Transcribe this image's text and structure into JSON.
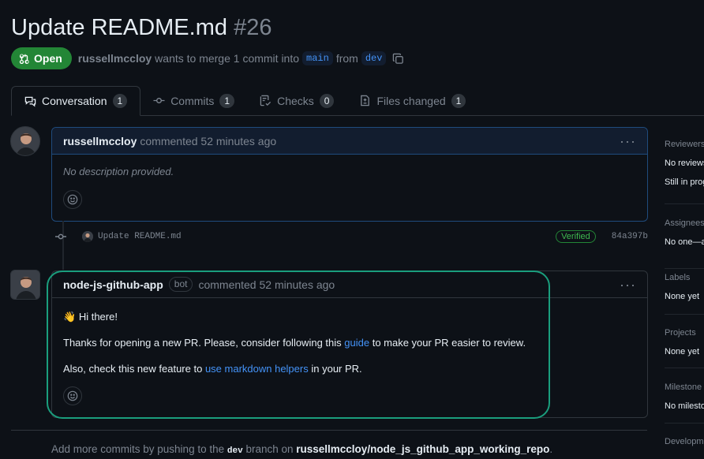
{
  "pr": {
    "title": "Update README.md",
    "number": "#26",
    "state": "Open",
    "author": "russellmccloy",
    "merge_text_a": "wants to merge 1 commit into",
    "base_branch": "main",
    "merge_text_b": "from",
    "head_branch": "dev"
  },
  "tabs": [
    {
      "label": "Conversation",
      "count": "1"
    },
    {
      "label": "Commits",
      "count": "1"
    },
    {
      "label": "Checks",
      "count": "0"
    },
    {
      "label": "Files changed",
      "count": "1"
    }
  ],
  "comment1": {
    "author": "russellmccloy",
    "meta": "commented 52 minutes ago",
    "body": "No description provided."
  },
  "commit": {
    "message": "Update README.md",
    "verified": "Verified",
    "sha": "84a397b"
  },
  "comment2": {
    "author": "node-js-github-app",
    "badge": "bot",
    "meta": "commented 52 minutes ago",
    "greeting": "Hi there!",
    "line2_a": "Thanks for opening a new PR. Please, consider following this",
    "line2_link": "guide",
    "line2_b": "to make your PR easier to review.",
    "line3_a": "Also, check this new feature to",
    "line3_link": "use markdown helpers",
    "line3_b": "in your PR."
  },
  "footer": {
    "a": "Add more commits by pushing to the",
    "branch": "dev",
    "b": "branch on",
    "repo": "russellmccloy/node_js_github_app_working_repo",
    "end": "."
  },
  "sidebar": {
    "reviewers_h": "Reviewers",
    "reviewers_v1": "No reviews",
    "reviewers_v2": "Still in prog",
    "assignees_h": "Assignees",
    "assignees_v": "No one—a",
    "labels_h": "Labels",
    "labels_v": "None yet",
    "projects_h": "Projects",
    "projects_v": "None yet",
    "milestone_h": "Milestone",
    "milestone_v": "No milesto",
    "development_h": "Developm"
  },
  "colors": {
    "accent": "#238636",
    "link": "#4493f8",
    "highlight": "#1a9e7d"
  }
}
